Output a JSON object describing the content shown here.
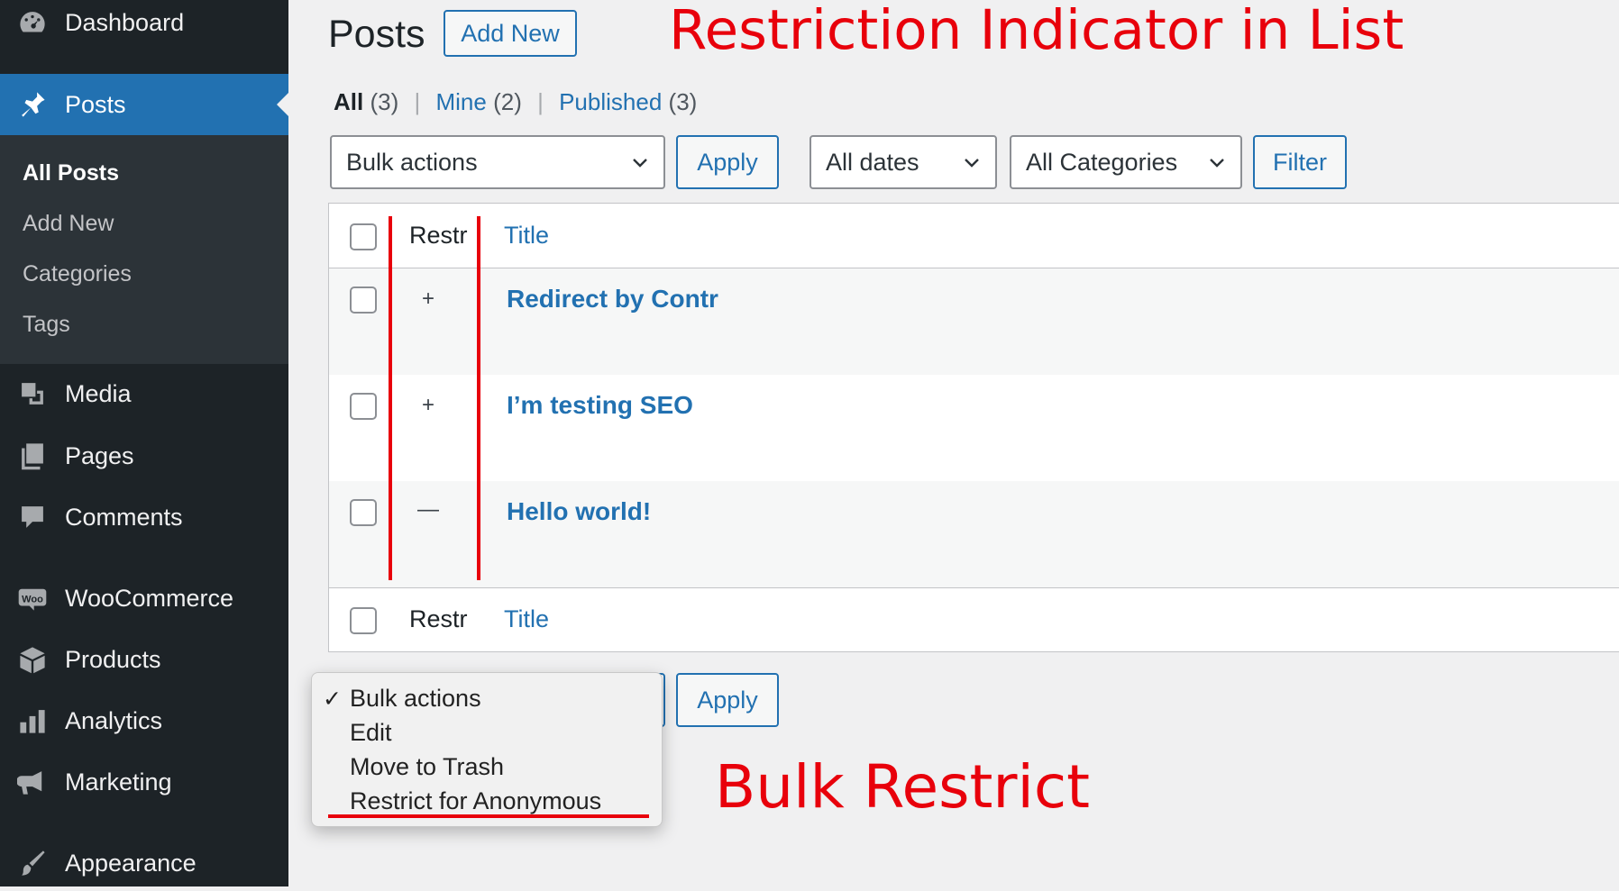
{
  "sidebar": {
    "items": [
      {
        "label": "Dashboard",
        "icon": "dashboard-icon"
      },
      {
        "label": "Posts",
        "icon": "pin-icon",
        "active": true
      },
      {
        "label": "Media",
        "icon": "media-icon"
      },
      {
        "label": "Pages",
        "icon": "pages-icon"
      },
      {
        "label": "Comments",
        "icon": "comments-icon"
      },
      {
        "label": "WooCommerce",
        "icon": "woo-icon"
      },
      {
        "label": "Products",
        "icon": "box-icon"
      },
      {
        "label": "Analytics",
        "icon": "bar-chart-icon"
      },
      {
        "label": "Marketing",
        "icon": "megaphone-icon"
      },
      {
        "label": "Appearance",
        "icon": "brush-icon"
      }
    ],
    "submenu": [
      "All Posts",
      "Add New",
      "Categories",
      "Tags"
    ]
  },
  "header": {
    "title": "Posts",
    "add_new": "Add New"
  },
  "filters": {
    "views": [
      {
        "label": "All",
        "count": "(3)"
      },
      {
        "label": "Mine",
        "count": "(2)"
      },
      {
        "label": "Published",
        "count": "(3)"
      }
    ],
    "separator": "|",
    "bulk_actions": "Bulk actions",
    "apply": "Apply",
    "dates": "All dates",
    "categories": "All Categories",
    "filter": "Filter"
  },
  "table": {
    "col_restr": "Restr",
    "col_title": "Title",
    "rows": [
      {
        "indicator": "+",
        "title": "Redirect by Contr"
      },
      {
        "indicator": "+",
        "title": "I’m testing SEO"
      },
      {
        "indicator": "—",
        "title": "Hello world!"
      }
    ]
  },
  "bottom": {
    "apply": "Apply",
    "dropdown": {
      "check": "✓",
      "options": [
        "Bulk actions",
        "Edit",
        "Move to Trash",
        "Restrict for Anonymous"
      ]
    }
  },
  "annotations": {
    "top": "Restriction Indicator in List",
    "bottom": "Bulk Restrict"
  },
  "colors": {
    "admin_blue": "#2271b1",
    "sidebar_dark": "#1d2327",
    "annotation_red": "#e8000b"
  }
}
